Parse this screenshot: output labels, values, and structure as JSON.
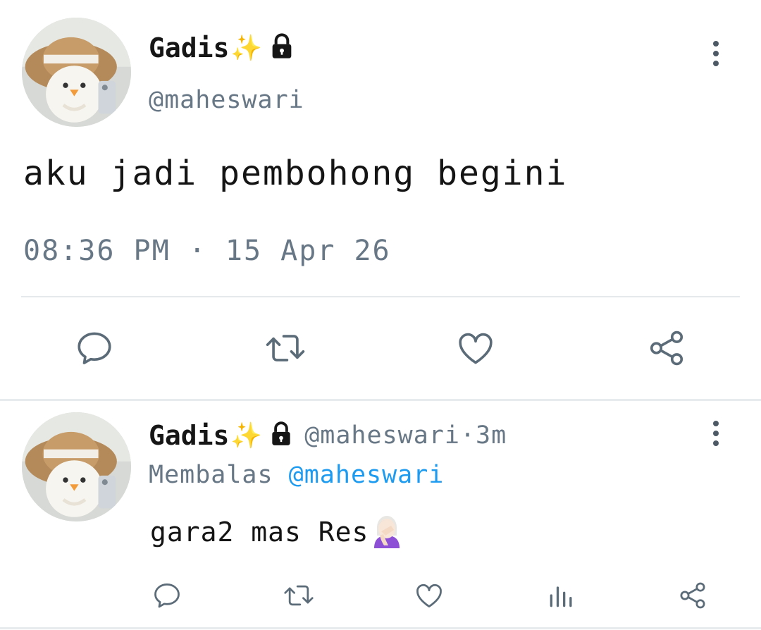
{
  "main_tweet": {
    "display_name": "Gadis",
    "sparkle": "✨",
    "handle": "@maheswari",
    "text": "aku jadi pembohong begini",
    "timestamp": "08:36 PM · 15 Apr 26",
    "actions": [
      "reply-icon",
      "retweet-icon",
      "like-icon",
      "share-icon"
    ]
  },
  "reply_tweet": {
    "display_name": "Gadis",
    "sparkle": "✨",
    "handle": "@maheswari",
    "separator": " · ",
    "time_ago": "3m",
    "replying_label": "Membalas ",
    "replying_to": "@maheswari",
    "text": "gara2 mas Res",
    "actions": [
      "reply-icon",
      "retweet-icon",
      "like-icon",
      "views-icon",
      "share-icon"
    ]
  },
  "colors": {
    "text": "#141414",
    "muted": "#687785",
    "mention": "#1d9bf0",
    "icon": "#5b6b78",
    "divider": "#e6e9ec"
  }
}
